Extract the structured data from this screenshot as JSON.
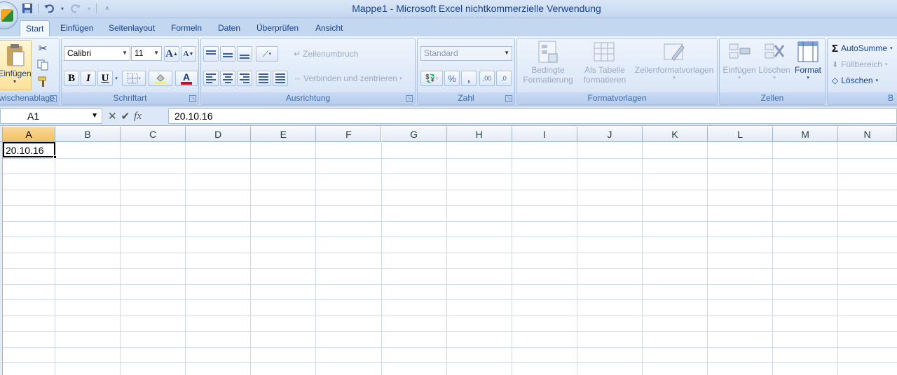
{
  "window": {
    "title": "Mappe1 - Microsoft Excel nichtkommerzielle Verwendung"
  },
  "qat": {
    "save_icon": "save-icon",
    "undo_icon": "undo-icon",
    "redo_icon": "redo-icon"
  },
  "tabs": [
    {
      "label": "Start"
    },
    {
      "label": "Einfügen"
    },
    {
      "label": "Seitenlayout"
    },
    {
      "label": "Formeln"
    },
    {
      "label": "Daten"
    },
    {
      "label": "Überprüfen"
    },
    {
      "label": "Ansicht"
    }
  ],
  "ribbon": {
    "clipboard": {
      "paste_label": "Einfügen",
      "group_label": "Zwischenablage"
    },
    "font": {
      "font_name": "Calibri",
      "font_size": "11",
      "grow": "A",
      "shrink": "A",
      "bold": "B",
      "italic": "I",
      "underline": "U",
      "font_color": "A",
      "group_label": "Schriftart"
    },
    "alignment": {
      "wrap_label": "Zeilenumbruch",
      "merge_label": "Verbinden und zentrieren",
      "group_label": "Ausrichtung"
    },
    "number": {
      "format_value": "Standard",
      "percent": "%",
      "comma": ",",
      "inc_dec": ",00",
      "dec_dec": ",0",
      "group_label": "Zahl"
    },
    "styles": {
      "cond_line1": "Bedingte",
      "cond_line2": "Formatierung",
      "table_line1": "Als Tabelle",
      "table_line2": "formatieren",
      "cell_styles": "Zellenformatvorlagen",
      "group_label": "Formatvorlagen"
    },
    "cells": {
      "insert": "Einfügen",
      "delete": "Löschen",
      "format": "Format",
      "group_label": "Zellen"
    },
    "editing": {
      "autosum": "AutoSumme",
      "fill": "Füllbereich",
      "clear": "Löschen",
      "sigma": "Σ",
      "group_label": "B"
    }
  },
  "formula_bar": {
    "name_box": "A1",
    "fx": "fx",
    "value": "20.10.16"
  },
  "grid": {
    "columns": [
      "A",
      "B",
      "C",
      "D",
      "E",
      "F",
      "G",
      "H",
      "I",
      "J",
      "K",
      "L",
      "M",
      "N"
    ],
    "selected_column": "A",
    "active_cell": {
      "ref": "A1",
      "value": "20.10.16"
    }
  }
}
